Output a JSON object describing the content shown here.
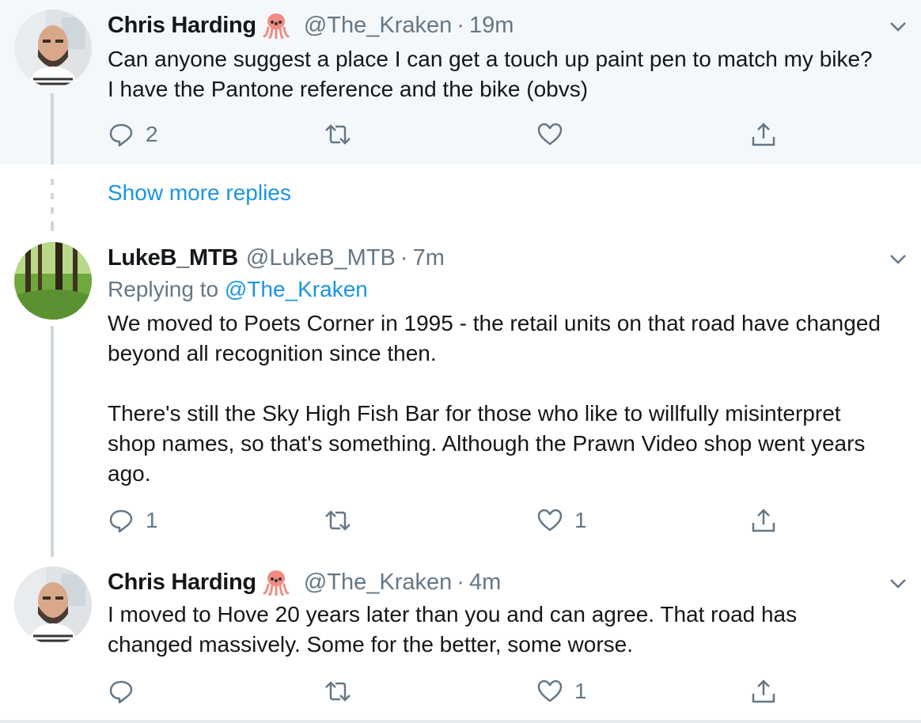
{
  "tweets": [
    {
      "name": "Chris Harding",
      "handle": "@The_Kraken",
      "time": "19m",
      "text": "Can anyone suggest a place I can get a touch up paint pen to match my bike?\nI have the Pantone reference and the bike (obvs)",
      "replies": "2",
      "retweets": "",
      "likes": ""
    },
    {
      "name": "LukeB_MTB",
      "handle": "@LukeB_MTB",
      "time": "7m",
      "replying_prefix": "Replying to",
      "replying_to": "@The_Kraken",
      "text": "We moved to Poets Corner in 1995 - the retail units on that road have changed\nbeyond all recognition since then.\n\nThere's still the Sky High Fish Bar for those who like to willfully misinterpret\nshop names, so that's something. Although the Prawn Video shop went years\nago.",
      "replies": "1",
      "retweets": "",
      "likes": "1"
    },
    {
      "name": "Chris Harding",
      "handle": "@The_Kraken",
      "time": "4m",
      "text": "I moved to Hove 20 years later than you and can agree. That road has\nchanged massively. Some for the better, some worse.",
      "replies": "",
      "retweets": "",
      "likes": "1"
    }
  ],
  "show_more": "Show more replies",
  "separator": "·",
  "colors": {
    "link": "#1b95e0",
    "muted": "#657786",
    "highlight_bg": "#f5f8fa",
    "thread_line": "#ccd6dd"
  }
}
